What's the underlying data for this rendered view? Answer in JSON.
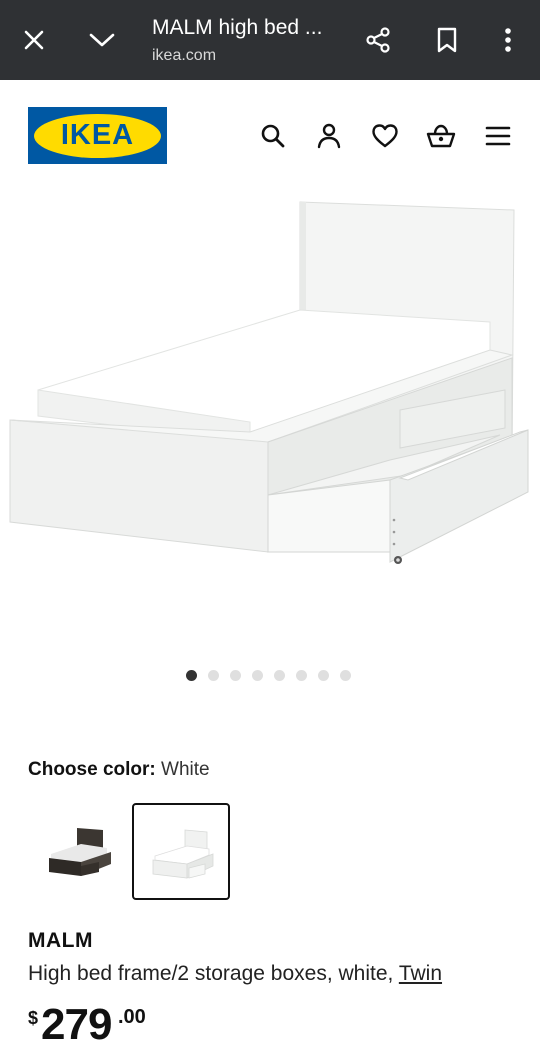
{
  "browser": {
    "title": "MALM high bed ...",
    "url": "ikea.com"
  },
  "header": {
    "logo_text": "IKEA",
    "brand_colors": {
      "blue": "#0058a3",
      "yellow": "#ffdb00"
    },
    "icons": [
      "search-icon",
      "user-icon",
      "heart-icon",
      "shopping-bag-icon",
      "menu-icon"
    ]
  },
  "gallery": {
    "image_count": 8,
    "active_index": 0
  },
  "color_picker": {
    "label": "Choose color:",
    "selected": "White",
    "options": [
      "black-brown",
      "white"
    ]
  },
  "product": {
    "name": "MALM",
    "description": "High bed frame/2 storage boxes, white,",
    "size_link": "Twin"
  },
  "price": {
    "currency": "$",
    "integer": "279",
    "decimal": ".00"
  }
}
